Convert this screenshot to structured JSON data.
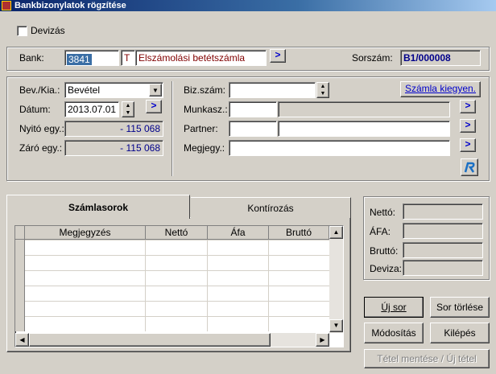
{
  "window": {
    "title": "Bankbizonylatok rögzítése"
  },
  "devizas": {
    "label": "Devizás",
    "checked": false
  },
  "bank": {
    "label": "Bank:",
    "code": "3841",
    "type_letter": "T",
    "name": "Elszámolási betétszámla",
    "arrow": ">",
    "sorszam_label": "Sorszám:",
    "sorszam_value": "B1/000008"
  },
  "form": {
    "bev_kia_label": "Bev./Kia.:",
    "bev_kia_value": "Bevétel",
    "datum_label": "Dátum:",
    "datum_value": "2013.07.01",
    "datum_arrow": ">",
    "nyito_label": "Nyitó egy.:",
    "nyito_value": "- 115 068",
    "zaro_label": "Záró egy.:",
    "zaro_value": "- 115 068",
    "biz_szam_label": "Biz.szám:",
    "biz_szam_value": "",
    "munkasz_label": "Munkasz.:",
    "munkasz_code": "",
    "munkasz_name": "",
    "partner_label": "Partner:",
    "partner_code": "",
    "partner_name": "",
    "megjegy_label": "Megjegy.:",
    "megjegy_value": "",
    "szamla_kiegyen_label": "Számla kiegyen.",
    "row_arrow": ">"
  },
  "tabs": [
    {
      "label": "Számlasorok",
      "active": true
    },
    {
      "label": "Kontírozás",
      "active": false
    }
  ],
  "table": {
    "columns": [
      "Megjegyzés",
      "Nettó",
      "Áfa",
      "Bruttó"
    ],
    "rows": []
  },
  "totals": {
    "netto_label": "Nettó:",
    "netto_value": "",
    "afa_label": "ÁFA:",
    "afa_value": "",
    "brutto_label": "Bruttó:",
    "brutto_value": "",
    "deviza_label": "Deviza:",
    "deviza_value": ""
  },
  "buttons": {
    "uj_sor": "Új sor",
    "sor_torlese": "Sor törlése",
    "modositas": "Módosítás",
    "kilepes": "Kilépés",
    "tetel_mentese": "Tétel mentése / Új tétel"
  },
  "colors": {
    "title_bg": "#0a246a",
    "dialog_bg": "#d4d0c8",
    "highlight": "#0a246a",
    "value_blue": "#00008b",
    "bank_name_red": "#800000"
  }
}
